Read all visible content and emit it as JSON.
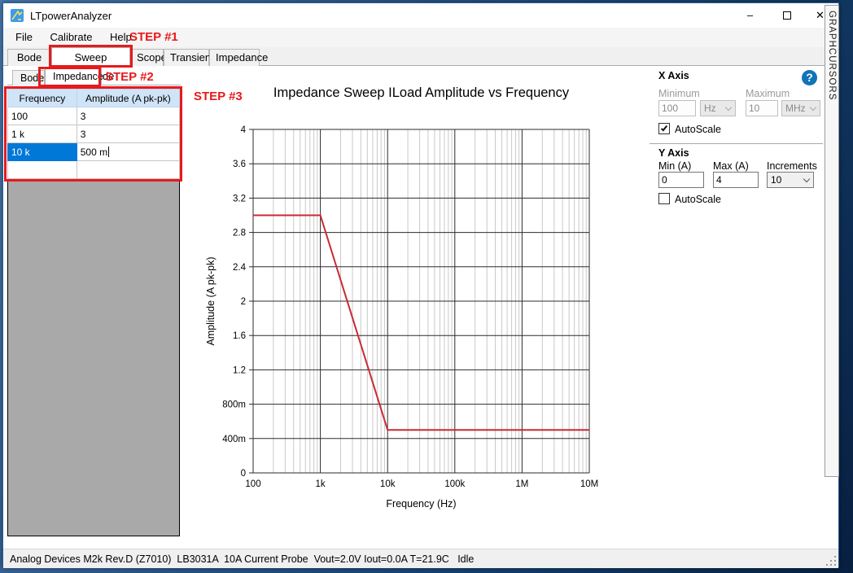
{
  "window": {
    "title": "LTpowerAnalyzer"
  },
  "icons": {
    "minimize": "–",
    "close": "✕",
    "help": "?"
  },
  "menu": {
    "items": [
      "File",
      "Calibrate",
      "Help"
    ]
  },
  "tabs": {
    "items": [
      "Bode Plot",
      "Sweep Amplitude",
      "Scope",
      "Transient",
      "Impedance"
    ],
    "selected": "Sweep Amplitude"
  },
  "subtabs": {
    "items": [
      "Bode",
      "Impedance"
    ],
    "selected": "Impedance"
  },
  "annotations": {
    "step1": "STEP #1",
    "step2": "STEP #2",
    "step3": "STEP #3"
  },
  "table": {
    "columns": [
      "Frequency",
      "Amplitude (A pk-pk)"
    ],
    "rows": [
      [
        "100",
        "3"
      ],
      [
        "1 k",
        "3"
      ],
      [
        "10 k",
        "500 m"
      ],
      [
        "",
        ""
      ]
    ],
    "selected_row": 2,
    "editing_cell": "500 m"
  },
  "x_axis_panel": {
    "title": "X Axis",
    "minimum_label": "Minimum",
    "minimum_value": "100",
    "minimum_unit": "Hz",
    "maximum_label": "Maximum",
    "maximum_value": "10",
    "maximum_unit": "MHz",
    "autoscale_label": "AutoScale",
    "autoscale_checked": true
  },
  "y_axis_panel": {
    "title": "Y Axis",
    "min_label": "Min (A)",
    "min_value": "0",
    "max_label": "Max (A)",
    "max_value": "4",
    "increments_label": "Increments",
    "increments_value": "10",
    "autoscale_label": "AutoScale",
    "autoscale_checked": false
  },
  "side_strip": {
    "graph": "GRAPH",
    "cursors": "CURSORS"
  },
  "status_bar": {
    "text": "Analog Devices M2k Rev.D (Z7010)  LB3031A  10A Current Probe  Vout=2.0V Iout=0.0A T=21.9C   Idle"
  },
  "chart_data": {
    "type": "line",
    "title": "Impedance Sweep ILoad Amplitude vs Frequency",
    "xlabel": "Frequency (Hz)",
    "ylabel": "Amplitude (A pk-pk)",
    "x_scale": "log",
    "xlim": [
      100,
      10000000
    ],
    "ylim": [
      0,
      4
    ],
    "y_increments": 10,
    "x_tick_labels": [
      "100",
      "1k",
      "10k",
      "100k",
      "1M",
      "10M"
    ],
    "y_tick_labels": [
      "0",
      "400m",
      "800m",
      "1.2",
      "1.6",
      "2",
      "2.4",
      "2.8",
      "3.2",
      "3.6",
      "4"
    ],
    "grid": true,
    "legend": "none",
    "series": [
      {
        "name": "ILoad Amplitude",
        "color": "#c82a35",
        "points": [
          [
            100,
            3
          ],
          [
            1000,
            3
          ],
          [
            10000,
            0.5
          ],
          [
            10000000,
            0.5
          ]
        ]
      }
    ]
  }
}
